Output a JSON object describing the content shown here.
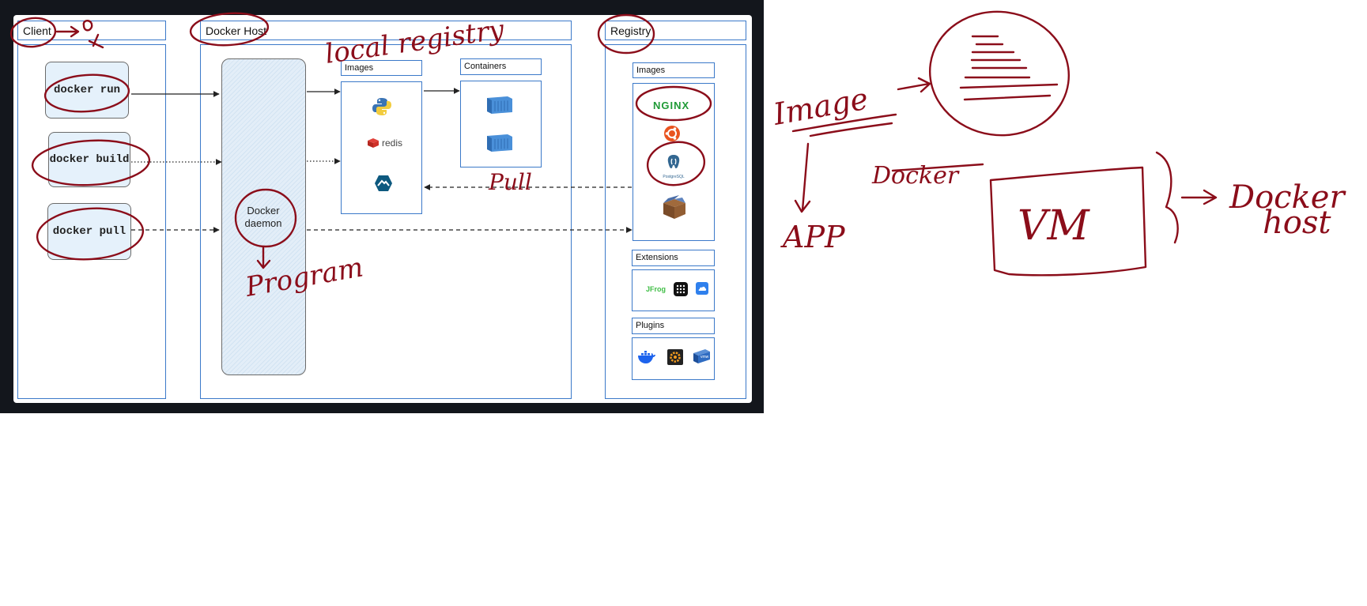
{
  "diagram": {
    "client": {
      "title": "Client",
      "commands": [
        "docker run",
        "docker build",
        "docker pull"
      ]
    },
    "host": {
      "title": "Docker Host",
      "images_label": "Images",
      "containers_label": "Containers",
      "redis_label": "redis",
      "daemon_line1": "Docker",
      "daemon_line2": "daemon"
    },
    "registry": {
      "title": "Registry",
      "images_label": "Images",
      "nginx_label": "NGINX",
      "postgres_label": "PostgreSQL",
      "extensions_label": "Extensions",
      "jfrog_label": "JFrog",
      "plugins_label": "Plugins",
      "vmware_label": "vmw"
    }
  },
  "annotations": {
    "local_registry": "local registry",
    "pull": "Pull",
    "program": "Program",
    "image": "Image",
    "app": "APP",
    "docker": "Docker",
    "vm": "VM",
    "docker_host_1": "Docker",
    "docker_host_2": "host"
  },
  "colors": {
    "diagram_border": "#3b79c9",
    "ink": "#8b0d1a",
    "screenshot_bg": "#13161c",
    "command_fill": "#e5f1fb"
  }
}
